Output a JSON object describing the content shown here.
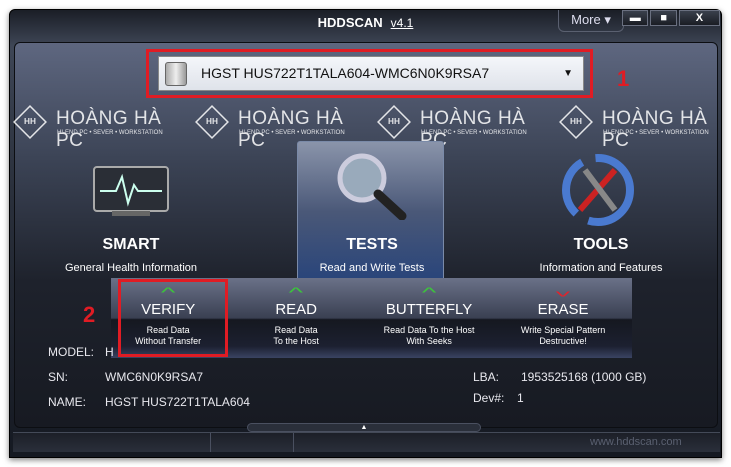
{
  "window": {
    "title": "HDDSCAN",
    "version": "v4.1",
    "more_label": "More ▾",
    "minimize": "▬",
    "maximize": "■",
    "close": "X"
  },
  "drive_select": {
    "value": "HGST HUS722T1TALA604-WMC6N0K9RSA7"
  },
  "annotations": {
    "one": "1",
    "two": "2"
  },
  "watermark": {
    "name": "HOÀNG HÀ PC",
    "tagline": "HI-END PC • SEVER • WORKSTATION",
    "mark": "HH"
  },
  "categories": [
    {
      "label": "SMART",
      "sub": "General Health Information"
    },
    {
      "label": "TESTS",
      "sub": "Read and Write Tests"
    },
    {
      "label": "TOOLS",
      "sub": "Information and Features"
    }
  ],
  "tests_menu": [
    {
      "title": "VERIFY",
      "desc1": "Read Data",
      "desc2": "Without Transfer",
      "kind": "read",
      "color": "#3cc43c"
    },
    {
      "title": "READ",
      "desc1": "Read Data",
      "desc2": "To the Host",
      "kind": "read",
      "color": "#3cc43c"
    },
    {
      "title": "BUTTERFLY",
      "desc1": "Read Data To the Host",
      "desc2": "With Seeks",
      "kind": "read",
      "color": "#3cc43c"
    },
    {
      "title": "ERASE",
      "desc1": "Write Special Pattern",
      "desc2": "Destructive!",
      "kind": "write",
      "color": "#e0242c"
    }
  ],
  "info": {
    "model_label": "MODEL:",
    "model_value": "H",
    "sn_label": "SN:",
    "sn_value": "WMC6N0K9RSA7",
    "name_label": "NAME:",
    "name_value": "HGST HUS722T1TALA604",
    "lba_label": "LBA:",
    "lba_value": "1953525168 (1000 GB)",
    "dev_label": "Dev#:",
    "dev_value": "1"
  },
  "footer": {
    "url": "www.hddscan.com",
    "handle": "▲"
  }
}
